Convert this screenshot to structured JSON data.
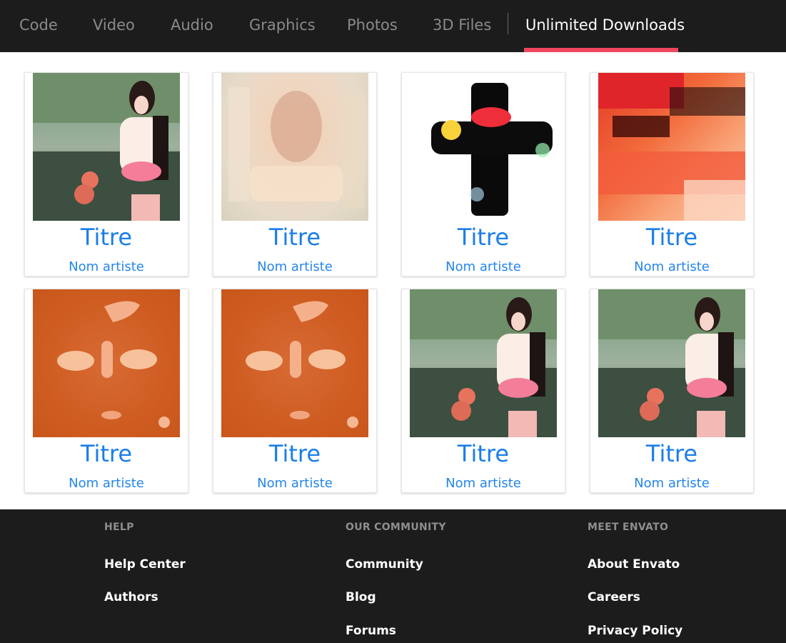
{
  "nav": {
    "items": [
      {
        "label": "Code"
      },
      {
        "label": "Video"
      },
      {
        "label": "Audio"
      },
      {
        "label": "Graphics"
      },
      {
        "label": "Photos"
      },
      {
        "label": "3D Files"
      },
      {
        "label": "Unlimited Downloads",
        "active": true
      }
    ],
    "accent_color": "#f04760"
  },
  "grid": {
    "cards": [
      {
        "title": "Titre",
        "artist": "Nom artiste",
        "thumbnail": "photo-woman-garden"
      },
      {
        "title": "Titre",
        "artist": "Nom artiste",
        "thumbnail": "blurred-beige-portrait"
      },
      {
        "title": "Titre",
        "artist": "Nom artiste",
        "thumbnail": "black-cross-splash"
      },
      {
        "title": "Titre",
        "artist": "Nom artiste",
        "thumbnail": "red-neon-abstract"
      },
      {
        "title": "Titre",
        "artist": "Nom artiste",
        "thumbnail": "orange-face-abstract"
      },
      {
        "title": "Titre",
        "artist": "Nom artiste",
        "thumbnail": "orange-face-abstract"
      },
      {
        "title": "Titre",
        "artist": "Nom artiste",
        "thumbnail": "photo-woman-garden"
      },
      {
        "title": "Titre",
        "artist": "Nom artiste",
        "thumbnail": "photo-woman-garden"
      }
    ],
    "title_color": "#1a7ee8"
  },
  "footer": {
    "columns": [
      {
        "heading": "HELP",
        "links": [
          "Help Center",
          "Authors"
        ]
      },
      {
        "heading": "OUR COMMUNITY",
        "links": [
          "Community",
          "Blog",
          "Forums"
        ]
      },
      {
        "heading": "MEET ENVATO",
        "links": [
          "About Envato",
          "Careers",
          "Privacy Policy"
        ]
      }
    ]
  }
}
